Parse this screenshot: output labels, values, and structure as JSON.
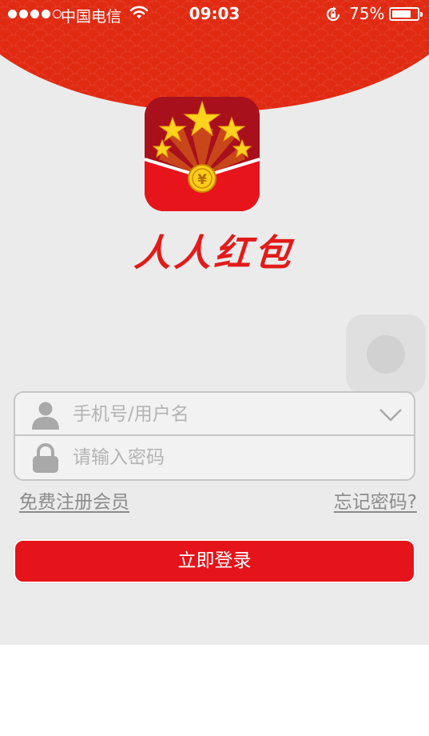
{
  "status_bar": {
    "carrier": "中国电信",
    "time": "09:03",
    "battery_percent": "75%",
    "battery_level": 0.75,
    "signal_bars_filled": 4,
    "signal_bars_total": 5
  },
  "branding": {
    "app_name": "人人红包",
    "logo_icon": "red-envelope-stars-icon",
    "logo_coin_symbol": "¥"
  },
  "login_form": {
    "username_placeholder": "手机号/用户名",
    "password_placeholder": "请输入密码",
    "username_icon": "user-icon",
    "password_icon": "lock-icon",
    "dropdown_icon": "chevron-down-icon"
  },
  "links": {
    "register": "免费注册会员",
    "forgot_password": "忘记密码?"
  },
  "login_button": "立即登录",
  "colors": {
    "brand_red": "#e5141a",
    "header_red": "#e12a12",
    "background": "#ebebeb"
  }
}
